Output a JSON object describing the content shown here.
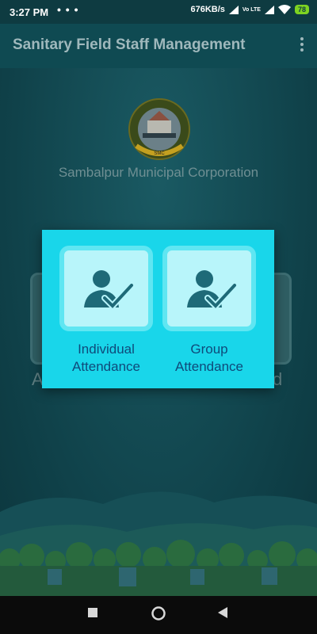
{
  "status": {
    "time": "3:27 PM",
    "speed": "676KB/s",
    "volte": "Vo LTE",
    "battery": "78",
    "notification_dots": "• • •"
  },
  "app": {
    "title": "Sanitary Field Staff Management",
    "org_name": "Sambalpur Municipal Corporation"
  },
  "logo": {
    "ring_text": "SAMBALPUR MUNICIPAL CORPORATION",
    "abbr": "SMC"
  },
  "background": {
    "left_letter": "A",
    "right_letter": "d"
  },
  "dialog": {
    "options": [
      {
        "line1": "Individual",
        "line2": "Attendance",
        "icon": "user-check-icon"
      },
      {
        "line1": "Group",
        "line2": "Attendance",
        "icon": "user-check-icon"
      }
    ]
  },
  "colors": {
    "appbar": "#0f4a52",
    "dialog": "#19d6ea",
    "tile": "#b8f5fa",
    "icon": "#1e6a78",
    "label": "#0f4a7a"
  }
}
